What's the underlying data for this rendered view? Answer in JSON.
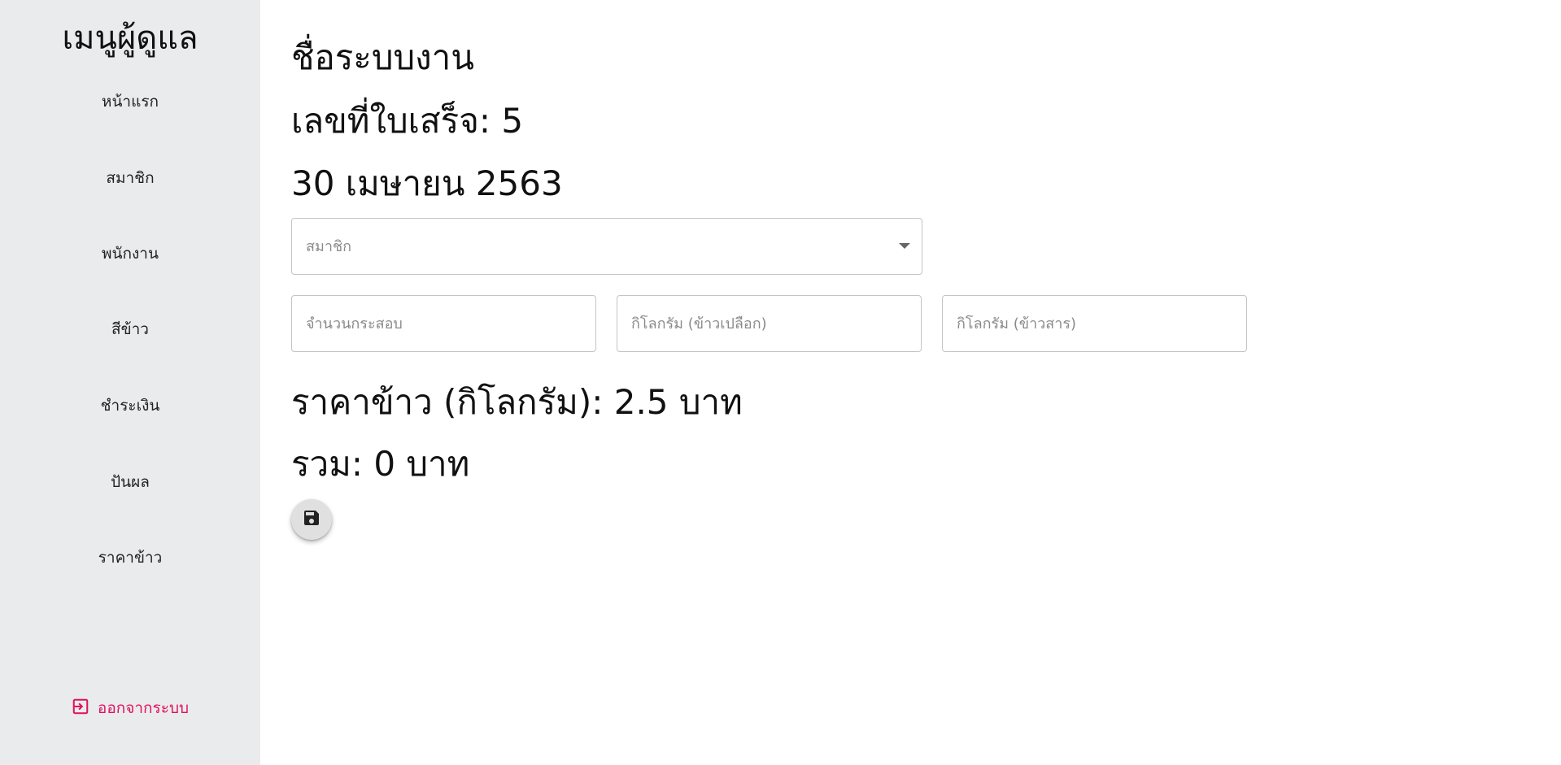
{
  "sidebar": {
    "title": "เมนูผู้ดูแล",
    "items": [
      {
        "label": "หน้าแรก"
      },
      {
        "label": "สมาชิก"
      },
      {
        "label": "พนักงาน"
      },
      {
        "label": "สีข้าว"
      },
      {
        "label": "ชำระเงิน"
      },
      {
        "label": "ปันผล"
      },
      {
        "label": "ราคาข้าว"
      }
    ],
    "logout_label": "ออกจากระบบ",
    "logout_color": "#e0115f"
  },
  "main": {
    "system_name": "ชื่อระบบงาน",
    "receipt_number": "เลขที่ใบเสร็จ: 5",
    "date": "30 เมษายน 2563",
    "member_select": {
      "placeholder": "สมาชิก",
      "icon": "chevron-down-icon"
    },
    "inputs": {
      "sack_count": {
        "placeholder": "จำนวนกระสอบ",
        "value": ""
      },
      "paddy_kg": {
        "placeholder": "กิโลกรัม (ข้าวเปลือก)",
        "value": ""
      },
      "milled_kg": {
        "placeholder": "กิโลกรัม (ข้าวสาร)",
        "value": ""
      }
    },
    "rice_price": "ราคาข้าว (กิโลกรัม): 2.5 บาท",
    "total": "รวม: 0 บาท",
    "save_icon": "save-icon"
  }
}
